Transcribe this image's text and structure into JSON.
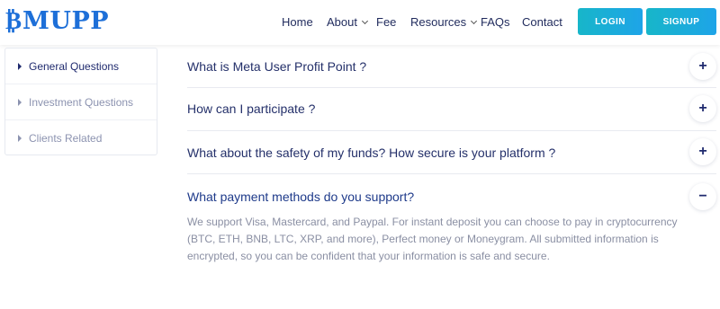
{
  "header": {
    "logo_mark": "₿",
    "logo_text": "MUPP",
    "nav": {
      "home": "Home",
      "about": "About",
      "fee": "Fee",
      "resources": "Resources",
      "faqs": "FAQs",
      "contact": "Contact"
    },
    "login_label": "LOGIN",
    "signup_label": "SIGNUP"
  },
  "sidebar": {
    "items": [
      {
        "label": "General Questions",
        "active": true
      },
      {
        "label": "Investment Questions",
        "active": false
      },
      {
        "label": "Clients Related",
        "active": false
      }
    ]
  },
  "faq": {
    "items": [
      {
        "question": "What is Meta User Profit Point ?",
        "toggle": "+"
      },
      {
        "question": "How can I participate ?",
        "toggle": "+"
      },
      {
        "question": "What about the safety of my funds? How secure is your platform ?",
        "toggle": "+"
      },
      {
        "question": "What payment methods do you support?",
        "toggle": "−",
        "answer": "We support Visa, Mastercard, and Paypal. For instant deposit you can choose to pay in cryptocurrency (BTC, ETH, BNB, LTC, XRP, and more), Perfect money or Moneygram. All submitted information is encrypted, so you can be confident that your information is safe and secure."
      }
    ]
  },
  "colors": {
    "brand": "#1d6fd8",
    "button_start": "#17b6c9",
    "button_end": "#1ea4e8",
    "heading": "#24306a",
    "muted": "#8a8fa3"
  }
}
